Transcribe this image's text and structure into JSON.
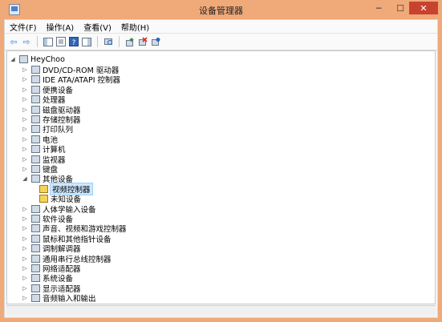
{
  "window": {
    "title": "设备管理器",
    "controls": {
      "minimize": "─",
      "maximize": "☐",
      "close": "✕"
    }
  },
  "menu": [
    "文件(F)",
    "操作(A)",
    "查看(V)",
    "帮助(H)"
  ],
  "toolbar": {
    "back": "⇦",
    "forward": "⇨"
  },
  "tree": {
    "root": "HeyChoo",
    "items": [
      {
        "label": "DVD/CD-ROM 驱动器",
        "icon": "dvd-icon",
        "expanded": false
      },
      {
        "label": "IDE ATA/ATAPI 控制器",
        "icon": "ide-controller-icon",
        "expanded": false
      },
      {
        "label": "便携设备",
        "icon": "portable-device-icon",
        "expanded": false
      },
      {
        "label": "处理器",
        "icon": "processor-icon",
        "expanded": false
      },
      {
        "label": "磁盘驱动器",
        "icon": "disk-drive-icon",
        "expanded": false
      },
      {
        "label": "存储控制器",
        "icon": "storage-controller-icon",
        "expanded": false
      },
      {
        "label": "打印队列",
        "icon": "printer-icon",
        "expanded": false
      },
      {
        "label": "电池",
        "icon": "battery-icon",
        "expanded": false
      },
      {
        "label": "计算机",
        "icon": "computer-icon",
        "expanded": false
      },
      {
        "label": "监视器",
        "icon": "monitor-icon",
        "expanded": false
      },
      {
        "label": "键盘",
        "icon": "keyboard-icon",
        "expanded": false
      },
      {
        "label": "其他设备",
        "icon": "other-devices-icon",
        "expanded": true,
        "children": [
          {
            "label": "视频控制器",
            "icon": "warning-device-icon",
            "selected": true
          },
          {
            "label": "未知设备",
            "icon": "warning-device-icon",
            "selected": false
          }
        ]
      },
      {
        "label": "人体学输入设备",
        "icon": "hid-icon",
        "expanded": false
      },
      {
        "label": "软件设备",
        "icon": "software-device-icon",
        "expanded": false
      },
      {
        "label": "声音、视频和游戏控制器",
        "icon": "sound-icon",
        "expanded": false
      },
      {
        "label": "鼠标和其他指针设备",
        "icon": "mouse-icon",
        "expanded": false
      },
      {
        "label": "调制解调器",
        "icon": "modem-icon",
        "expanded": false
      },
      {
        "label": "通用串行总线控制器",
        "icon": "usb-icon",
        "expanded": false
      },
      {
        "label": "网络适配器",
        "icon": "network-adapter-icon",
        "expanded": false
      },
      {
        "label": "系统设备",
        "icon": "system-device-icon",
        "expanded": false
      },
      {
        "label": "显示适配器",
        "icon": "display-adapter-icon",
        "expanded": false
      },
      {
        "label": "音频输入和输出",
        "icon": "audio-io-icon",
        "expanded": false
      }
    ]
  }
}
